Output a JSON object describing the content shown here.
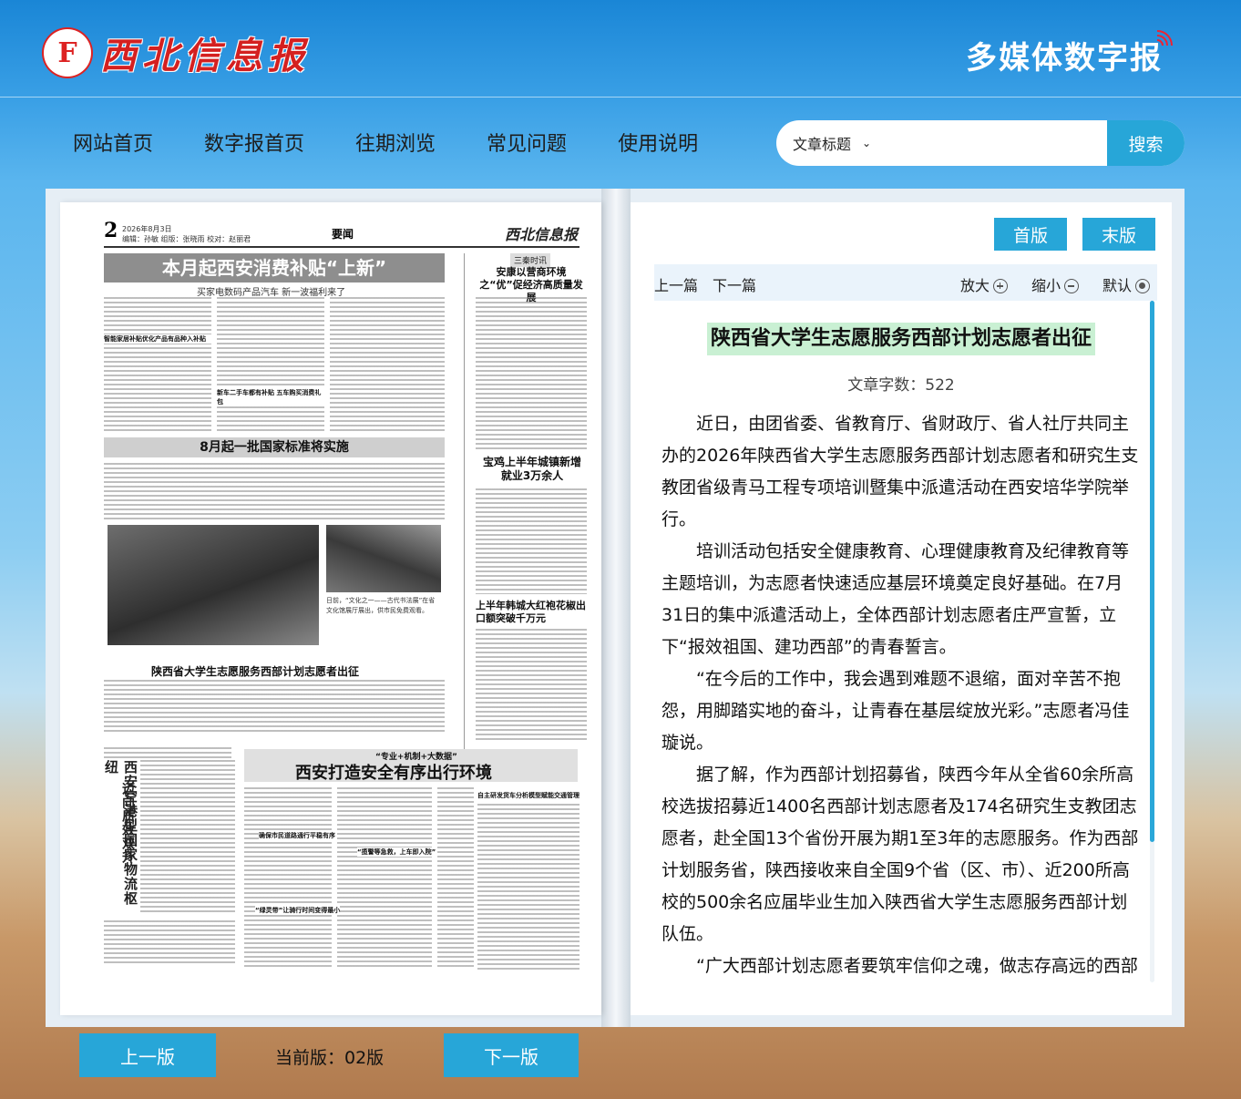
{
  "header": {
    "logo_emblem": "F",
    "logo_text": "西北信息报",
    "brand": "多媒体数字报"
  },
  "nav": [
    {
      "label": "网站首页"
    },
    {
      "label": "数字报首页"
    },
    {
      "label": "往期浏览"
    },
    {
      "label": "常见问题"
    },
    {
      "label": "使用说明"
    }
  ],
  "search": {
    "field": "文章标题",
    "button": "搜索"
  },
  "newspaper": {
    "page_number": "2",
    "date": "2026年8月3日",
    "editors": "编辑：孙敏  组版：张晓雨  校对：赵丽君",
    "section": "要闻",
    "logo": "西北信息报",
    "headline1": "本月起西安消费补贴“上新”",
    "headline1_sub": "买家电数码产品汽车  新一波福利来了",
    "subhead1a": "智能家居补贴优化产品有品种入补贴",
    "subhead1b": "新车二手车都有补贴  五车购买消费礼包",
    "headline2": "8月起一批国家标准将实施",
    "photo_caption": "日前，“文化之一——古代书法展”在省文化馆展厅展出，供市民免费观看。",
    "headline3": "陕西省大学生志愿服务西部计划志愿者出征",
    "side_tag": "三秦时讯",
    "side_h1": "安康以营商环境之“优”促经济高质量发展",
    "side_h2": "宝鸡上半年城镇新增就业3万余人",
    "side_h3": "上半年韩城大红袍花椒出口额突破千万元",
    "vert_title": "西安空港型国家物流枢纽",
    "vert_sub": "迈向质效双升",
    "headline4_kicker": "“专业+机制+大数据”",
    "headline4": "西安打造安全有序出行环境",
    "subhead4a": "确保市民道路通行平稳有序",
    "subhead4b": "“绿灵带”让骑行时间变得最小",
    "subhead4c": "“揽警等急救，上车即入院”",
    "subhead4d": "自主研发货车分析模型赋能交通管理"
  },
  "reader": {
    "first_page": "首版",
    "last_page": "末版",
    "prev_article": "上一篇",
    "next_article": "下一篇",
    "zoom_in": "放大",
    "zoom_out": "缩小",
    "default": "默认",
    "title": "陕西省大学生志愿服务西部计划志愿者出征",
    "word_count": "文章字数：522",
    "paragraphs": [
      "近日，由团省委、省教育厅、省财政厅、省人社厅共同主办的2026年陕西省大学生志愿服务西部计划志愿者和研究生支教团省级青马工程专项培训暨集中派遣活动在西安培华学院举行。",
      "培训活动包括安全健康教育、心理健康教育及纪律教育等主题培训，为志愿者快速适应基层环境奠定良好基础。在7月31日的集中派遣活动上，全体西部计划志愿者庄严宣誓，立下“报效祖国、建功西部”的青春誓言。",
      "“在今后的工作中，我会遇到难题不退缩，面对辛苦不抱怨，用脚踏实地的奋斗，让青春在基层绽放光彩。”志愿者冯佳璇说。",
      "据了解，作为西部计划招募省，陕西今年从全省60余所高校选拔招募近1400名西部计划志愿者及174名研究生支教团志愿者，赴全国13个省份开展为期1至3年的志愿服务。作为西部计划服务省，陕西接收来自全国9个省（区、市）、近200所高校的500余名应届毕业生加入陕西省大学生志愿服务西部计划队伍。",
      "“广大西部计划志愿者要筑牢信仰之魂，做志存高远的西部计划志愿者"
    ]
  },
  "bottom": {
    "prev_page": "上一版",
    "current_page": "当前版：02版",
    "next_page": "下一版"
  }
}
